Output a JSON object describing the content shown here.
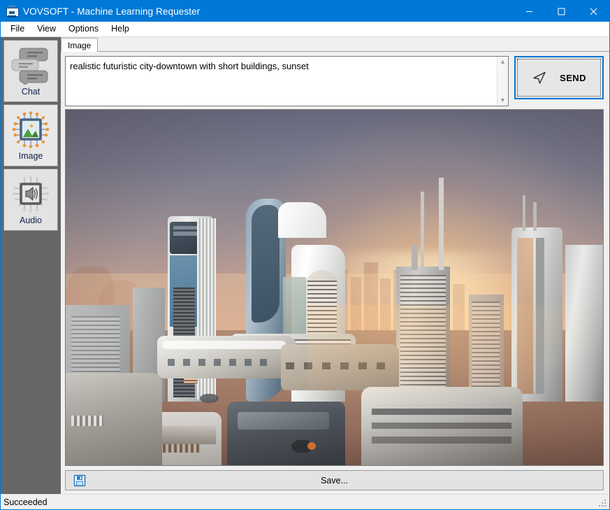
{
  "window": {
    "title": "VOVSOFT - Machine Learning Requester",
    "app_icon": "cloud-monitor-icon",
    "controls": {
      "minimize": "minimize-icon",
      "maximize": "maximize-icon",
      "close": "close-icon"
    },
    "titlebar_color": "#0078d7"
  },
  "menubar": {
    "items": [
      {
        "label": "File"
      },
      {
        "label": "View"
      },
      {
        "label": "Options"
      },
      {
        "label": "Help"
      }
    ]
  },
  "sidebar": {
    "background": "#666666",
    "items": [
      {
        "label": "Chat",
        "icon": "chat-bubbles-icon",
        "active": false
      },
      {
        "label": "Image",
        "icon": "image-chip-icon",
        "active": true
      },
      {
        "label": "Audio",
        "icon": "audio-speaker-chip-icon",
        "active": false
      }
    ]
  },
  "main": {
    "tabs": [
      {
        "label": "Image",
        "selected": true
      }
    ],
    "prompt": {
      "value": "realistic futuristic city-downtown with short buildings, sunset",
      "placeholder": "",
      "scrollbar": {
        "up": "chevron-up-icon",
        "down": "chevron-down-icon"
      }
    },
    "send_button": {
      "label": "SEND",
      "icon": "paper-plane-icon",
      "focused": true,
      "focus_color": "#0078d7"
    },
    "result_image": {
      "alt": "generated futuristic city downtown at sunset",
      "description": "AI generated image of a futuristic downtown city with curved white towers, a glowing sunset on the horizon and elongated vehicles on a tiled street"
    },
    "save_button": {
      "label": "Save...",
      "icon": "floppy-disk-icon"
    }
  },
  "statusbar": {
    "text": "Succeeded",
    "grip": "resize-grip-icon"
  }
}
